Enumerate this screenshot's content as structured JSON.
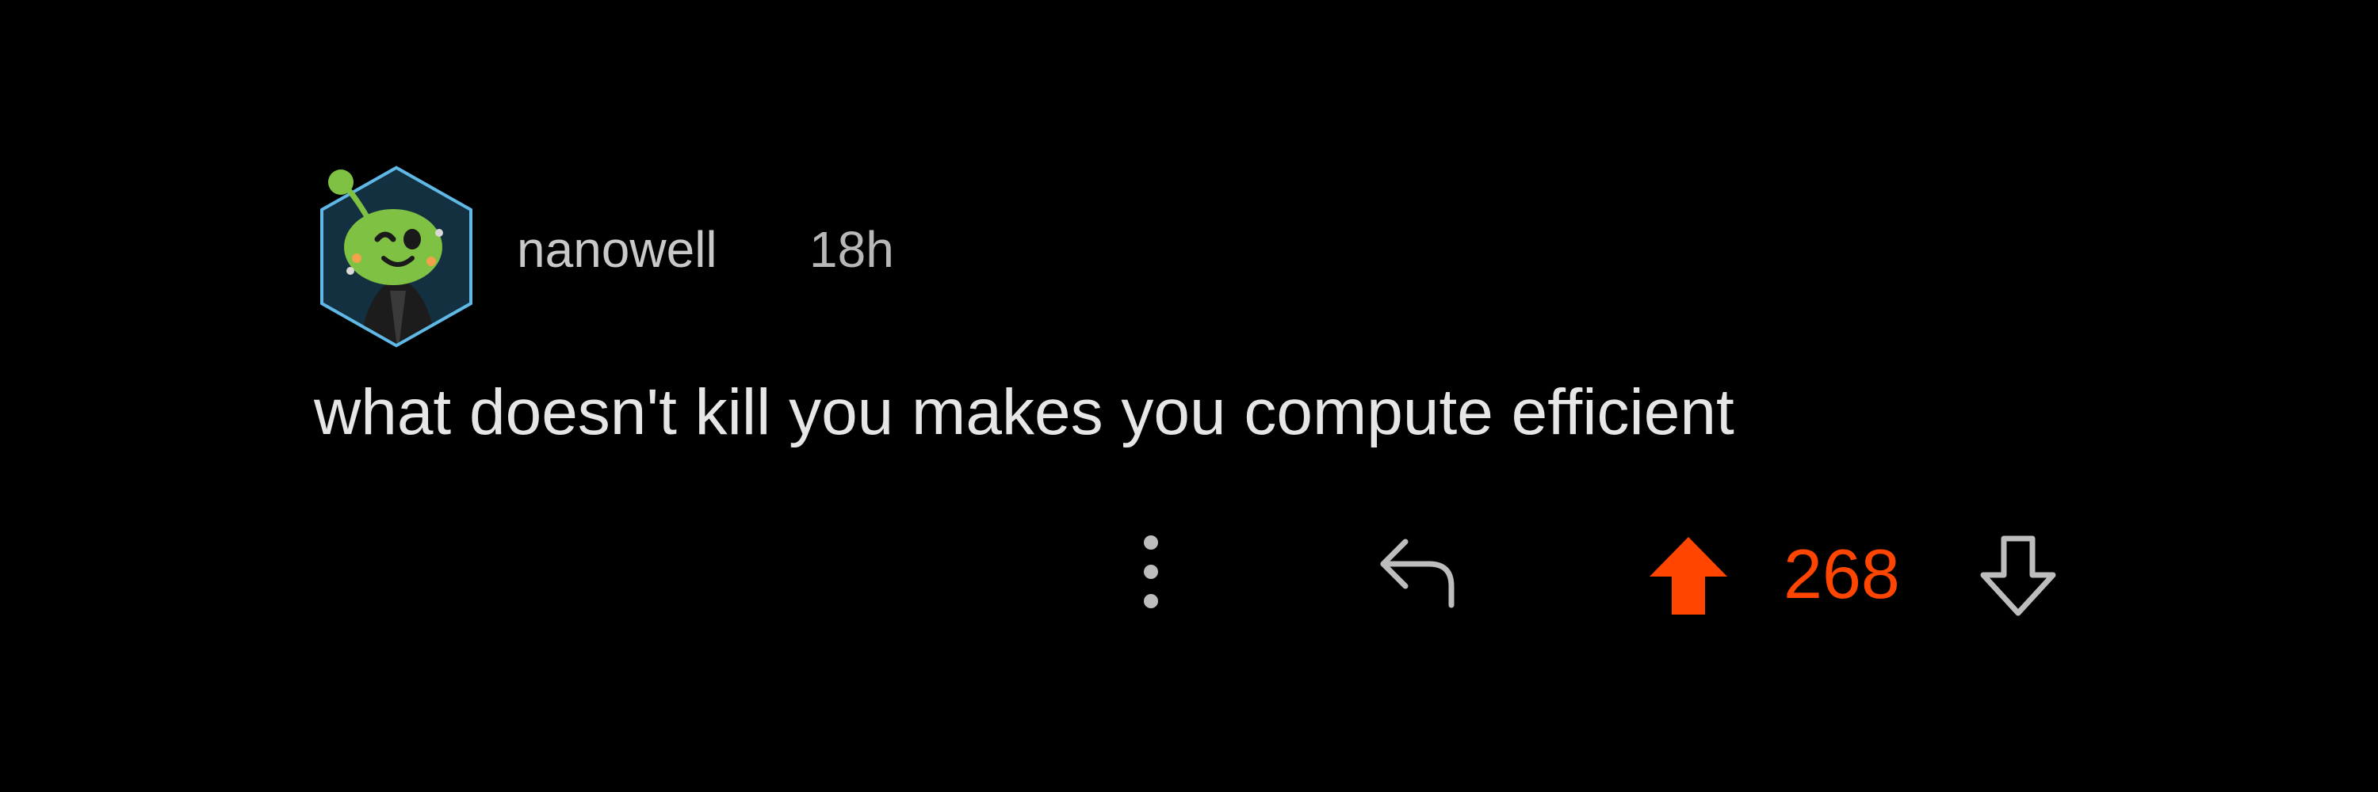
{
  "comment": {
    "username": "nanowell",
    "age": "18h",
    "text": "what doesn't kill you makes you compute efficient",
    "vote_count": "268",
    "vote_state": "upvoted"
  },
  "icons": {
    "avatar": "snoo-avatar",
    "more": "more-vertical-icon",
    "reply": "reply-icon",
    "upvote": "upvote-filled-icon",
    "downvote": "downvote-outline-icon"
  },
  "colors": {
    "background": "#000000",
    "upvote_accent": "#ff4500",
    "username": "#c9c9c9",
    "body_text": "#e6e6e6",
    "icon_gray": "#bdbdbd"
  }
}
